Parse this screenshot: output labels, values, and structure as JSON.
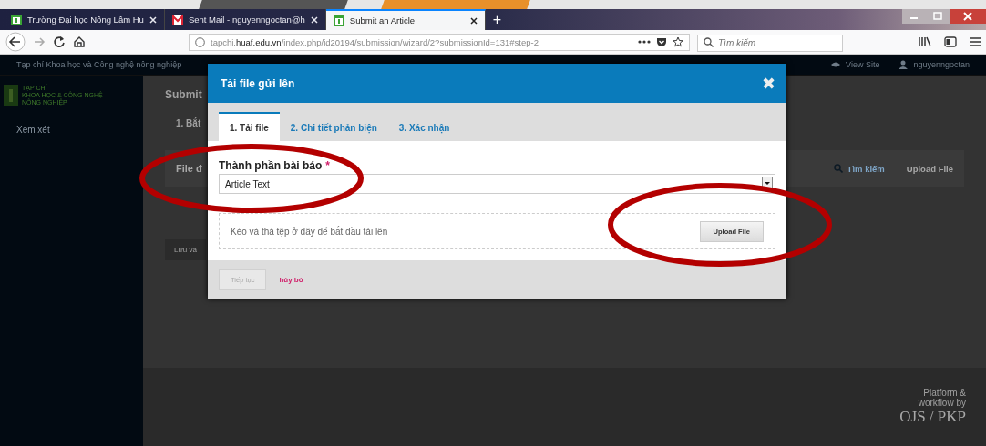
{
  "browser": {
    "tabs": [
      {
        "title": "Trường Đại học Nông Lâm Hu",
        "selected": false
      },
      {
        "title": "Sent Mail - nguyenngoctan@h",
        "selected": false
      },
      {
        "title": "Submit an Article",
        "selected": true
      }
    ],
    "new_tab": "+",
    "url": "tapchi.**huaf.edu.vn**/index.php/id20194/submission/wizard/2?submissionId=131#step-2",
    "search": {
      "placeholder": "Tìm kiếm"
    }
  },
  "site": {
    "header_title": "Tạp chí Khoa học và Công nghệ nông nghiệp",
    "header_links": [
      "View Site",
      "nguyenngoctan"
    ],
    "logo_lines": [
      "TẠP CHÍ",
      "KHOA HỌC & CÔNG NGHỆ",
      "NÔNG NGHIỆP"
    ],
    "sidebar": {
      "items": [
        {
          "label": "Xem xét",
          "selected": false
        }
      ]
    },
    "heading": "Submit",
    "step": "1. Bắt",
    "panel_title": "File đ",
    "panel_actions": [
      {
        "label": "Tìm kiếm",
        "kind": "search"
      },
      {
        "label": "Upload File",
        "kind": "plain"
      }
    ],
    "save_button": "Lưu và",
    "footer": {
      "text": "Platform & workflow by",
      "logo": "OJS / PKP"
    }
  },
  "modal": {
    "title": "Tải file gửi lên",
    "close": "✖",
    "tabs": [
      {
        "label": "1. Tải file",
        "selected": true
      },
      {
        "label": "2. Chi tiết phản biện",
        "selected": false
      },
      {
        "label": "3. Xác nhận",
        "selected": false
      }
    ],
    "field": {
      "label": "Thành phần bài báo",
      "required": true,
      "required_mark": "*",
      "value": "Article Text"
    },
    "dropzone": {
      "text": "Kéo và thả tệp ở đây để bắt đầu tải lên",
      "button": "Upload File"
    },
    "continue": {
      "label": "Tiếp tục",
      "disabled": true
    },
    "cancel": "hủy bỏ"
  }
}
